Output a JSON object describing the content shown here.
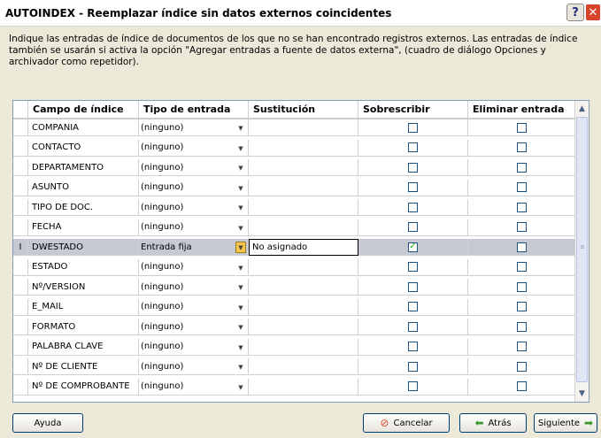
{
  "window": {
    "title": "AUTOINDEX - Reemplazar índice sin datos externos coincidentes",
    "help_label": "?",
    "close_label": "✕"
  },
  "description": "Indique las entradas de índice de documentos de los que no se han encontrado registros externos. Las entradas de índice también se usarán si activa la opción \"Agregar entradas a fuente de datos externa\", (cuadro de diálogo Opciones y archivador como repetidor).",
  "table": {
    "headers": [
      "Campo de índice",
      "Tipo de entrada",
      "Sustitución",
      "Sobrescribir",
      "Eliminar entrada"
    ],
    "rows": [
      {
        "campo": "COMPANIA",
        "tipo": "(ninguno)",
        "sust": "",
        "sobrescribir": "",
        "eliminar": "",
        "mark": ""
      },
      {
        "campo": "CONTACTO",
        "tipo": "(ninguno)",
        "sust": "",
        "sobrescribir": "",
        "eliminar": "",
        "mark": ""
      },
      {
        "campo": "DEPARTAMENTO",
        "tipo": "(ninguno)",
        "sust": "",
        "sobrescribir": "",
        "eliminar": "",
        "mark": ""
      },
      {
        "campo": "ASUNTO",
        "tipo": "(ninguno)",
        "sust": "",
        "sobrescribir": "",
        "eliminar": "",
        "mark": ""
      },
      {
        "campo": "TIPO DE DOC.",
        "tipo": "(ninguno)",
        "sust": "",
        "sobrescribir": "",
        "eliminar": "",
        "mark": ""
      },
      {
        "campo": "FECHA",
        "tipo": "(ninguno)",
        "sust": "",
        "sobrescribir": "",
        "eliminar": "",
        "mark": ""
      },
      {
        "campo": "DWESTADO",
        "tipo": "Entrada fija",
        "sust": "No asignado",
        "sobrescribir": "✓",
        "eliminar": "",
        "mark": "I"
      },
      {
        "campo": "ESTADO",
        "tipo": "(ninguno)",
        "sust": "",
        "sobrescribir": "",
        "eliminar": "",
        "mark": ""
      },
      {
        "campo": "Nº/VERSION",
        "tipo": "(ninguno)",
        "sust": "",
        "sobrescribir": "",
        "eliminar": "",
        "mark": ""
      },
      {
        "campo": "E_MAIL",
        "tipo": "(ninguno)",
        "sust": "",
        "sobrescribir": "",
        "eliminar": "",
        "mark": ""
      },
      {
        "campo": "FORMATO",
        "tipo": "(ninguno)",
        "sust": "",
        "sobrescribir": "",
        "eliminar": "",
        "mark": ""
      },
      {
        "campo": "PALABRA CLAVE",
        "tipo": "(ninguno)",
        "sust": "",
        "sobrescribir": "",
        "eliminar": "",
        "mark": ""
      },
      {
        "campo": "Nº DE CLIENTE",
        "tipo": "(ninguno)",
        "sust": "",
        "sobrescribir": "",
        "eliminar": "",
        "mark": ""
      },
      {
        "campo": "Nº DE COMPROBANTE",
        "tipo": "(ninguno)",
        "sust": "",
        "sobrescribir": "",
        "eliminar": "",
        "mark": ""
      }
    ]
  },
  "buttons": {
    "help": "Ayuda",
    "cancel": "Cancelar",
    "back": "Atrás",
    "next": "Siguiente"
  },
  "icons": {
    "cancel": "no-entry-icon",
    "back": "green-left-arrow-icon",
    "next": "green-right-arrow-icon"
  },
  "colors": {
    "window_bg": "#ece9d8",
    "selected_row": "#c6c8d4",
    "check_green": "#21a121",
    "cancel_red": "#d8432b",
    "arrow_green": "#3a9a2a"
  }
}
